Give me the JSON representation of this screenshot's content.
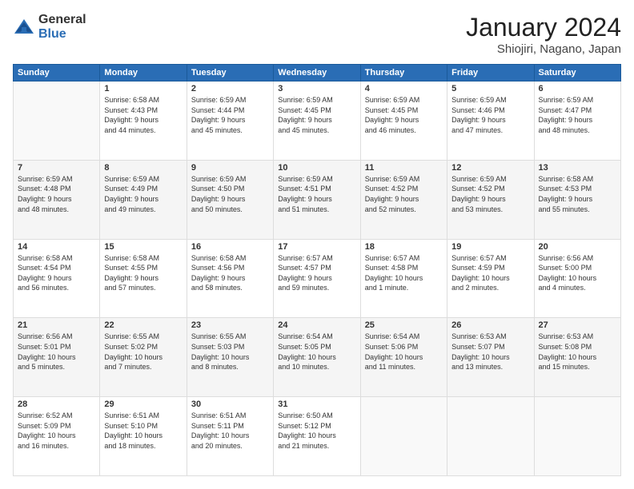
{
  "logo": {
    "general": "General",
    "blue": "Blue"
  },
  "header": {
    "month": "January 2024",
    "location": "Shiojiri, Nagano, Japan"
  },
  "weekdays": [
    "Sunday",
    "Monday",
    "Tuesday",
    "Wednesday",
    "Thursday",
    "Friday",
    "Saturday"
  ],
  "weeks": [
    [
      {
        "day": "",
        "info": ""
      },
      {
        "day": "1",
        "info": "Sunrise: 6:58 AM\nSunset: 4:43 PM\nDaylight: 9 hours\nand 44 minutes."
      },
      {
        "day": "2",
        "info": "Sunrise: 6:59 AM\nSunset: 4:44 PM\nDaylight: 9 hours\nand 45 minutes."
      },
      {
        "day": "3",
        "info": "Sunrise: 6:59 AM\nSunset: 4:45 PM\nDaylight: 9 hours\nand 45 minutes."
      },
      {
        "day": "4",
        "info": "Sunrise: 6:59 AM\nSunset: 4:45 PM\nDaylight: 9 hours\nand 46 minutes."
      },
      {
        "day": "5",
        "info": "Sunrise: 6:59 AM\nSunset: 4:46 PM\nDaylight: 9 hours\nand 47 minutes."
      },
      {
        "day": "6",
        "info": "Sunrise: 6:59 AM\nSunset: 4:47 PM\nDaylight: 9 hours\nand 48 minutes."
      }
    ],
    [
      {
        "day": "7",
        "info": "Sunrise: 6:59 AM\nSunset: 4:48 PM\nDaylight: 9 hours\nand 48 minutes."
      },
      {
        "day": "8",
        "info": "Sunrise: 6:59 AM\nSunset: 4:49 PM\nDaylight: 9 hours\nand 49 minutes."
      },
      {
        "day": "9",
        "info": "Sunrise: 6:59 AM\nSunset: 4:50 PM\nDaylight: 9 hours\nand 50 minutes."
      },
      {
        "day": "10",
        "info": "Sunrise: 6:59 AM\nSunset: 4:51 PM\nDaylight: 9 hours\nand 51 minutes."
      },
      {
        "day": "11",
        "info": "Sunrise: 6:59 AM\nSunset: 4:52 PM\nDaylight: 9 hours\nand 52 minutes."
      },
      {
        "day": "12",
        "info": "Sunrise: 6:59 AM\nSunset: 4:52 PM\nDaylight: 9 hours\nand 53 minutes."
      },
      {
        "day": "13",
        "info": "Sunrise: 6:58 AM\nSunset: 4:53 PM\nDaylight: 9 hours\nand 55 minutes."
      }
    ],
    [
      {
        "day": "14",
        "info": "Sunrise: 6:58 AM\nSunset: 4:54 PM\nDaylight: 9 hours\nand 56 minutes."
      },
      {
        "day": "15",
        "info": "Sunrise: 6:58 AM\nSunset: 4:55 PM\nDaylight: 9 hours\nand 57 minutes."
      },
      {
        "day": "16",
        "info": "Sunrise: 6:58 AM\nSunset: 4:56 PM\nDaylight: 9 hours\nand 58 minutes."
      },
      {
        "day": "17",
        "info": "Sunrise: 6:57 AM\nSunset: 4:57 PM\nDaylight: 9 hours\nand 59 minutes."
      },
      {
        "day": "18",
        "info": "Sunrise: 6:57 AM\nSunset: 4:58 PM\nDaylight: 10 hours\nand 1 minute."
      },
      {
        "day": "19",
        "info": "Sunrise: 6:57 AM\nSunset: 4:59 PM\nDaylight: 10 hours\nand 2 minutes."
      },
      {
        "day": "20",
        "info": "Sunrise: 6:56 AM\nSunset: 5:00 PM\nDaylight: 10 hours\nand 4 minutes."
      }
    ],
    [
      {
        "day": "21",
        "info": "Sunrise: 6:56 AM\nSunset: 5:01 PM\nDaylight: 10 hours\nand 5 minutes."
      },
      {
        "day": "22",
        "info": "Sunrise: 6:55 AM\nSunset: 5:02 PM\nDaylight: 10 hours\nand 7 minutes."
      },
      {
        "day": "23",
        "info": "Sunrise: 6:55 AM\nSunset: 5:03 PM\nDaylight: 10 hours\nand 8 minutes."
      },
      {
        "day": "24",
        "info": "Sunrise: 6:54 AM\nSunset: 5:05 PM\nDaylight: 10 hours\nand 10 minutes."
      },
      {
        "day": "25",
        "info": "Sunrise: 6:54 AM\nSunset: 5:06 PM\nDaylight: 10 hours\nand 11 minutes."
      },
      {
        "day": "26",
        "info": "Sunrise: 6:53 AM\nSunset: 5:07 PM\nDaylight: 10 hours\nand 13 minutes."
      },
      {
        "day": "27",
        "info": "Sunrise: 6:53 AM\nSunset: 5:08 PM\nDaylight: 10 hours\nand 15 minutes."
      }
    ],
    [
      {
        "day": "28",
        "info": "Sunrise: 6:52 AM\nSunset: 5:09 PM\nDaylight: 10 hours\nand 16 minutes."
      },
      {
        "day": "29",
        "info": "Sunrise: 6:51 AM\nSunset: 5:10 PM\nDaylight: 10 hours\nand 18 minutes."
      },
      {
        "day": "30",
        "info": "Sunrise: 6:51 AM\nSunset: 5:11 PM\nDaylight: 10 hours\nand 20 minutes."
      },
      {
        "day": "31",
        "info": "Sunrise: 6:50 AM\nSunset: 5:12 PM\nDaylight: 10 hours\nand 21 minutes."
      },
      {
        "day": "",
        "info": ""
      },
      {
        "day": "",
        "info": ""
      },
      {
        "day": "",
        "info": ""
      }
    ]
  ]
}
